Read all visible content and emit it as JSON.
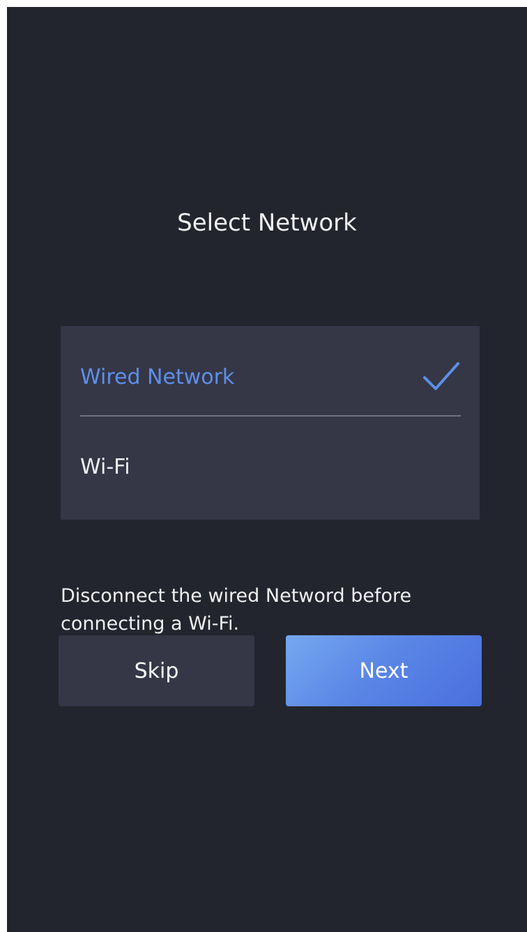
{
  "header": {
    "title": "Select Network"
  },
  "network_options": [
    {
      "label": "Wired Network",
      "selected": true,
      "icon": "checkmark-icon"
    },
    {
      "label": "Wi-Fi",
      "selected": false
    }
  ],
  "note": "Disconnect the wired Netword before connecting a Wi-Fi.",
  "buttons": {
    "skip_label": "Skip",
    "next_label": "Next"
  },
  "colors": {
    "background": "#23252e",
    "panel": "#353747",
    "accent": "#5e8fe8",
    "primary_button": "#5b87e6"
  }
}
